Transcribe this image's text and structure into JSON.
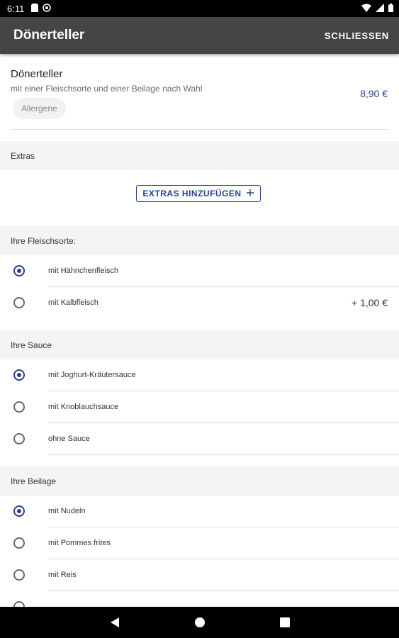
{
  "status_bar": {
    "time": "6:11",
    "left_icons": [
      "sim-card-icon",
      "whatsapp-icon"
    ],
    "right_icons": [
      "wifi-icon",
      "signal-icon",
      "battery-icon"
    ]
  },
  "app_bar": {
    "title": "Dönerteller",
    "close_label": "SCHLIESSEN"
  },
  "product": {
    "name": "Dönerteller",
    "description": "mit einer Fleischsorte und einer Beilage nach Wahl",
    "price": "8,90 €",
    "allergens_label": "Allergene"
  },
  "extras": {
    "header": "Extras",
    "button_label": "EXTRAS HINZUFÜGEN",
    "button_icon": "plus-icon"
  },
  "meat": {
    "header": "Ihre Fleischsorte:",
    "options": [
      {
        "label": "mit Hähnchenfleisch",
        "price": "",
        "selected": true
      },
      {
        "label": "mit Kalbfleisch",
        "price": "+ 1,00 €",
        "selected": false
      }
    ]
  },
  "sauce": {
    "header": "Ihre Sauce",
    "options": [
      {
        "label": "mit Joghurt-Kräutersauce",
        "selected": true
      },
      {
        "label": "mit Knoblauchsauce",
        "selected": false
      },
      {
        "label": "ohne Sauce",
        "selected": false
      }
    ]
  },
  "side": {
    "header": "Ihre Beilage",
    "options": [
      {
        "label": "mit Nudeln",
        "selected": true
      },
      {
        "label": "mit Pommes frites",
        "selected": false
      },
      {
        "label": "mit Reis",
        "selected": false
      }
    ]
  },
  "nav_bar": {
    "icons": [
      "back-icon",
      "home-icon",
      "recents-icon"
    ]
  },
  "colors": {
    "accent": "#2a3d8f",
    "app_bar": "#454545",
    "section_bg": "#f4f4f4"
  }
}
